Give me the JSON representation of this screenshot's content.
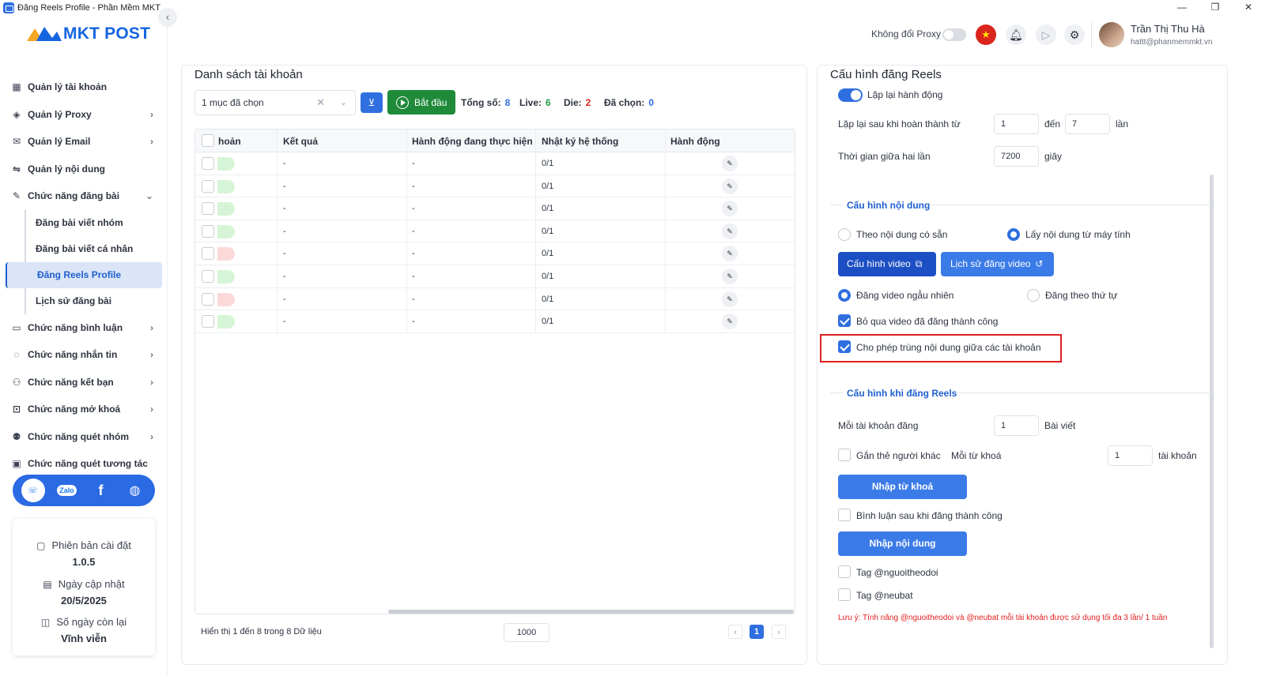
{
  "window": {
    "title": "Đăng Reels Profile - Phần Mềm MKT",
    "controls": [
      "—",
      "❐",
      "✕"
    ]
  },
  "brand": {
    "logo_text": "MKT POST",
    "accent": "#1565e0"
  },
  "sidebar": {
    "items": [
      {
        "label": "Quản lý tài khoản",
        "icon": "dashboard-icon"
      },
      {
        "label": "Quản lý Proxy",
        "icon": "layers-icon",
        "has_chevron": true
      },
      {
        "label": "Quản lý Email",
        "icon": "mail-icon",
        "has_chevron": true
      },
      {
        "label": "Quản lý nội dung",
        "icon": "content-icon"
      },
      {
        "label": "Chức năng đăng bài",
        "icon": "post-icon",
        "expanded": true
      },
      {
        "label": "Chức năng bình luận",
        "icon": "comment-icon",
        "has_chevron": true
      },
      {
        "label": "Chức năng nhắn tin",
        "icon": "chat-icon",
        "has_chevron": true
      },
      {
        "label": "Chức năng kết bạn",
        "icon": "add-friend-icon",
        "has_chevron": true
      },
      {
        "label": "Chức năng mở khoá",
        "icon": "unlock-icon",
        "has_chevron": true
      },
      {
        "label": "Chức năng quét nhóm",
        "icon": "group-icon",
        "has_chevron": true
      },
      {
        "label": "Chức năng quét tương tác",
        "icon": "scan-icon"
      }
    ],
    "subitems": [
      {
        "label": "Đăng bài viết nhóm"
      },
      {
        "label": "Đăng bài viết cá nhân"
      },
      {
        "label": "Đăng Reels Profile",
        "active": true
      },
      {
        "label": "Lịch sử đăng bài"
      }
    ],
    "social": [
      "support-icon",
      "Zalo",
      "facebook-icon",
      "globe-icon"
    ],
    "info": {
      "version_label": "Phiên bản cài đặt",
      "version_value": "1.0.5",
      "update_label": "Ngày cập nhật",
      "update_value": "20/5/2025",
      "days_label": "Số ngày còn lại",
      "days_value": "Vĩnh viễn"
    }
  },
  "topbar": {
    "proxy_label": "Không đổi Proxy",
    "proxy_enabled": false,
    "user_name": "Trần Thị Thu Hà",
    "user_email": "hattt@phanmemmkt.vn"
  },
  "accounts": {
    "title": "Danh sách tài khoản",
    "select_value": "1 mục đã chọn",
    "start_label": "Bắt đầu",
    "total_label": "Tổng số:",
    "total_value": "8",
    "live_label": "Live:",
    "live_value": "6",
    "die_label": "Die:",
    "die_value": "2",
    "selected_label": "Đã chọn:",
    "selected_value": "0",
    "columns": [
      "hoản",
      "Kết quả",
      "Hành động đang thực hiện",
      "Nhật ký hệ thống",
      "Hành động"
    ],
    "rows": [
      {
        "status": "live",
        "result": "-",
        "action": "-",
        "log": "0/1"
      },
      {
        "status": "live",
        "result": "-",
        "action": "-",
        "log": "0/1"
      },
      {
        "status": "live",
        "result": "-",
        "action": "-",
        "log": "0/1"
      },
      {
        "status": "live",
        "result": "-",
        "action": "-",
        "log": "0/1"
      },
      {
        "status": "die",
        "result": "-",
        "action": "-",
        "log": "0/1"
      },
      {
        "status": "live",
        "result": "-",
        "action": "-",
        "log": "0/1"
      },
      {
        "status": "die",
        "result": "-",
        "action": "-",
        "log": "0/1"
      },
      {
        "status": "live",
        "result": "-",
        "action": "-",
        "log": "0/1"
      }
    ],
    "footer_text": "Hiển thị 1 đến 8 trong 8 Dữ liệu",
    "page_size": "1000",
    "current_page": "1",
    "prev": "‹",
    "next": "›"
  },
  "config": {
    "title": "Cấu hình đăng Reels",
    "repeat_label": "Lặp lại hành động",
    "repeat_enabled": true,
    "repeat_after_label": "Lặp lại sau khi hoàn thành từ",
    "repeat_from": "1",
    "to_label": "đến",
    "repeat_to": "7",
    "times_label": "lần",
    "interval_label": "Thời gian giữa hai lần",
    "interval_value": "7200",
    "seconds_label": "giây",
    "content_section": "Cấu hình nội dung",
    "content_opt1": "Theo nội dung có sẵn",
    "content_opt2": "Lấy nội dung từ máy tính",
    "video_config_btn": "Cấu hình video",
    "video_history_btn": "Lịch sử đăng video",
    "order_opt1": "Đăng video ngẫu nhiên",
    "order_opt2": "Đăng theo thứ tự",
    "skip_posted_label": "Bỏ qua video đã đăng thành công",
    "skip_posted": true,
    "allow_dup_label": "Cho phép trùng nội dung giữa các tài khoản",
    "allow_dup": true,
    "reels_section": "Cấu hình khi đăng Reels",
    "per_account_label": "Mỗi tài khoản đăng",
    "per_account_value": "1",
    "posts_label": "Bài viết",
    "tag_others_label": "Gắn thẻ người khác",
    "per_keyword_label": "Mỗi từ khoá",
    "per_keyword_value": "1",
    "accounts_label": "tài khoản",
    "import_keywords_btn": "Nhập từ khoá",
    "comment_after_label": "Bình luận sau khi đăng thành công",
    "import_content_btn": "Nhập nội dung",
    "tag_follower_label": "Tag @nguoitheodoi",
    "tag_friend_label": "Tag @neubat",
    "note": "Lưu ý: Tính năng @nguoitheodoi và @neubat mỗi tài khoản được sử dụng tối đa 3 lần/ 1 tuần",
    "note_color": "#e02020"
  }
}
